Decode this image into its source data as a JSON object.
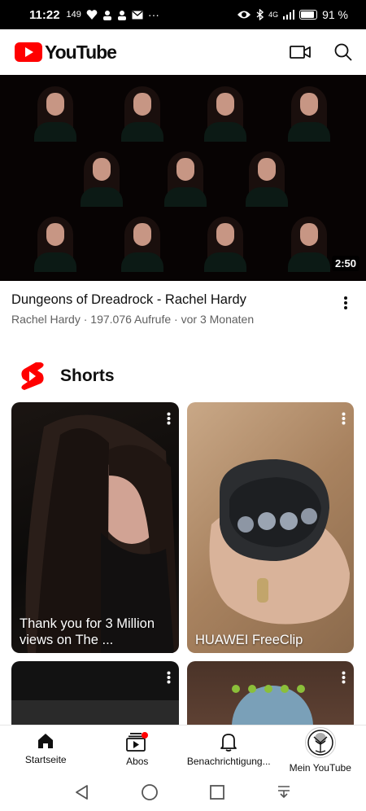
{
  "status_bar": {
    "time": "11:22",
    "small_text": "149",
    "network": "4G",
    "battery": "91 %"
  },
  "app": {
    "logo_text": "YouTube",
    "brand_color": "#ff0000"
  },
  "video": {
    "duration": "2:50",
    "title": "Dungeons of Dreadrock - Rachel Hardy",
    "channel": "Rachel Hardy",
    "views": "197.076 Aufrufe",
    "age": "vor 3 Monaten",
    "separator": "·"
  },
  "shorts": {
    "title": "Shorts",
    "cards": [
      {
        "label": "Thank you for 3 Million views on The ..."
      },
      {
        "label": "HUAWEI FreeClip"
      },
      {
        "label": ""
      },
      {
        "label": ""
      }
    ]
  },
  "bottom_nav": {
    "items": [
      {
        "label": "Startseite",
        "icon": "home-icon"
      },
      {
        "label": "Abos",
        "icon": "subscriptions-icon"
      },
      {
        "label": "Benachrichtigung...",
        "icon": "bell-icon"
      },
      {
        "label": "Mein YouTube",
        "icon": "avatar"
      }
    ]
  },
  "icons": {
    "camera": "video-camera-icon",
    "search": "search-icon",
    "more": "more-vert-icon",
    "shorts": "shorts-icon"
  }
}
